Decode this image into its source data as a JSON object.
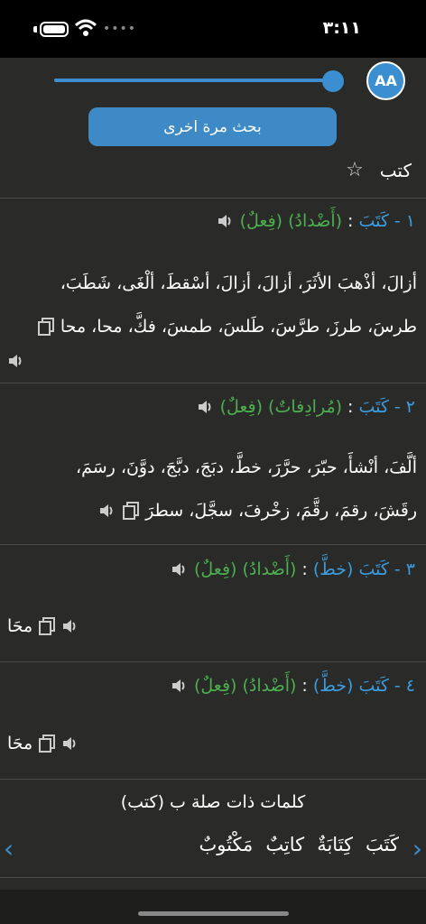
{
  "status": {
    "time": "٣:١١"
  },
  "toolbar": {
    "aa_label": "AA",
    "font_size_fraction": 0.96,
    "search_again": "بحث مرة اخرى"
  },
  "word": {
    "title": "كتب"
  },
  "entries": [
    {
      "num": "١ -",
      "word": "كَتَبَ",
      "sep": ":",
      "rel": "(أَضْدادُ)",
      "pos": "(فِعلٌ)",
      "line1": "أزالَ، أذْهبَ الأثَرَ، أزالَ، أزالَ، أسْقطَ، ألْغَى، شَطَبَ،",
      "line2": "طرسَ، طرزَ، طرَّسَ، طَلسَ، طمسَ، فكَّ، محا، محا"
    },
    {
      "num": "٢ -",
      "word": "كَتَبَ",
      "sep": ":",
      "rel": "(مُرادِفاتٌ)",
      "pos": "(فِعلٌ)",
      "line1": "ألَّفَ، أنْشأَ، حبّرَ، حرَّرَ، خطَّ، دبَجَ، دبَّجَ، دوَّنَ، رسَمَ،",
      "line2": "رقَشَ، رقمَ، رقَّمَ، زخْرفَ، سجَّلَ، سطرَ"
    },
    {
      "num": "٣ -",
      "word": "كَتَبَ",
      "word2": "(خطَّ)",
      "sep": ":",
      "rel": "(أَضْدادُ)",
      "pos": "(فِعلٌ)",
      "line1": "محَا"
    },
    {
      "num": "٤ -",
      "word": "كَتَبَ",
      "word2": "(خطَّ)",
      "sep": ":",
      "rel": "(أَضْدادُ)",
      "pos": "(فِعلٌ)",
      "line1": "محَا"
    }
  ],
  "related": {
    "title": "كلمات ذات صلة ب (كتب)",
    "words": [
      "كَتَبَ",
      "كِتَابَةٌ",
      "كاتِبٌ",
      "مَكْتُوبٌ"
    ],
    "prev": "‹",
    "next": "›"
  },
  "colors": {
    "accent": "#3b8fd0",
    "green": "#4caf50",
    "background": "#2a2a28"
  }
}
